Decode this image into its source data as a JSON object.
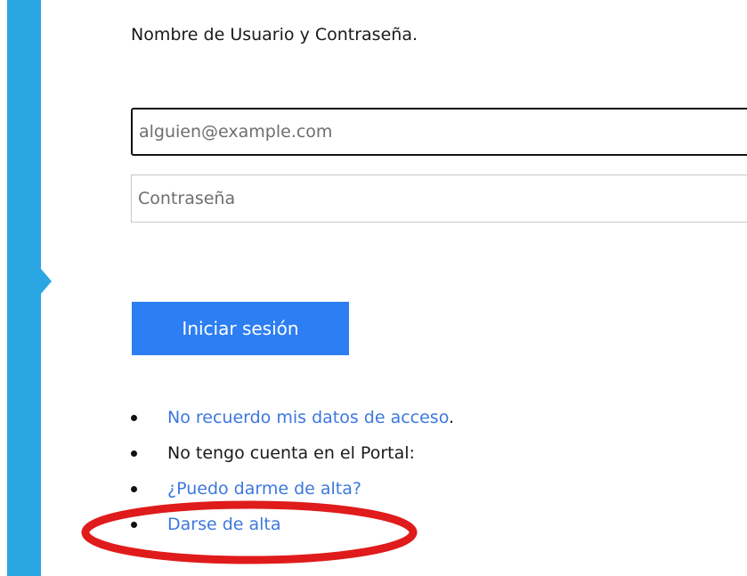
{
  "form": {
    "instructions": "Nombre de Usuario y Contraseña.",
    "email_placeholder": "alguien@example.com",
    "email_value": "",
    "password_placeholder": "Contraseña",
    "password_value": "",
    "login_button": "Iniciar sesión"
  },
  "links": {
    "forgot": "No recuerdo mis datos de acceso",
    "forgot_suffix": ".",
    "no_account": "No tengo cuenta en el Portal:",
    "can_register": "¿Puedo darme de alta?",
    "register": "Darse de alta"
  },
  "colors": {
    "accent_bar": "#2aa6e3",
    "button": "#2d7ef2",
    "link": "#3c78e0",
    "annotation": "#e01b1b"
  }
}
